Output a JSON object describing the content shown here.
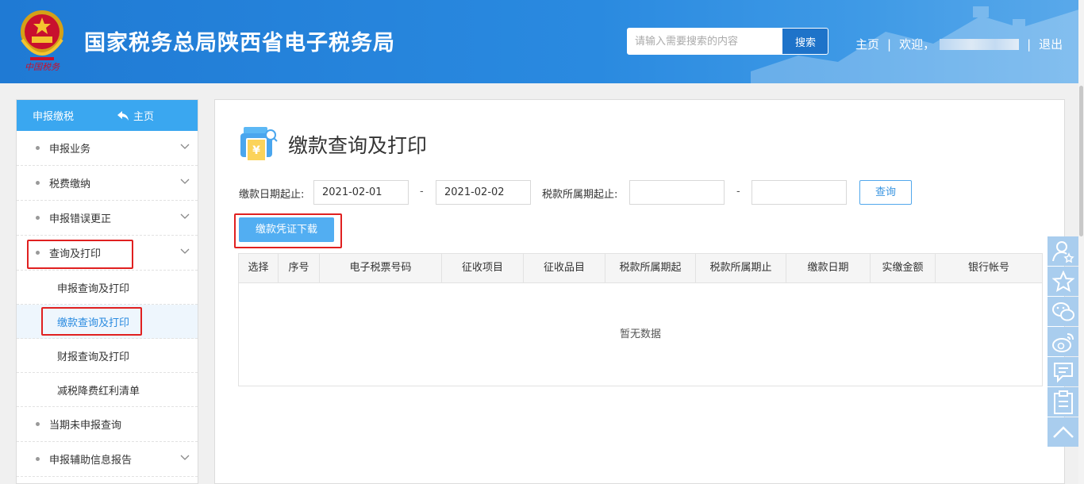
{
  "header": {
    "site_title": "国家税务总局陕西省电子税务局",
    "search_placeholder": "请输入需要搜索的内容",
    "search_button": "搜索",
    "home_link": "主页",
    "separator": "|",
    "welcome": "欢迎，",
    "logout": "退出",
    "emblem_caption": "中国税务"
  },
  "sidebar": {
    "title": "申报缴税",
    "home": "主页",
    "items": [
      {
        "label": "申报业务"
      },
      {
        "label": "税费缴纳"
      },
      {
        "label": "申报错误更正"
      },
      {
        "label": "查询及打印"
      }
    ],
    "subitems": [
      {
        "label": "申报查询及打印"
      },
      {
        "label": "缴款查询及打印"
      },
      {
        "label": "财报查询及打印"
      },
      {
        "label": "减税降费红利清单"
      }
    ],
    "items_after": [
      {
        "label": "当期未申报查询"
      },
      {
        "label": "申报辅助信息报告"
      }
    ]
  },
  "main": {
    "title": "缴款查询及打印",
    "filters": {
      "pay_date_label": "缴款日期起止:",
      "pay_date_start": "2021-02-01",
      "pay_date_end": "2021-02-02",
      "dash": "-",
      "period_label": "税款所属期起止:",
      "period_start": "",
      "period_end": ""
    },
    "query_button": "查询",
    "download_button": "缴款凭证下载",
    "table": {
      "columns": [
        "选择",
        "序号",
        "电子税票号码",
        "征收项目",
        "征收品目",
        "税款所属期起",
        "税款所属期止",
        "缴款日期",
        "实缴金额",
        "银行帐号"
      ],
      "empty_text": "暂无数据"
    }
  },
  "tools": [
    "user-star-icon",
    "star-icon",
    "wechat-icon",
    "weibo-icon",
    "feedback-icon",
    "clipboard-icon",
    "back-to-top-icon"
  ],
  "colors": {
    "header_blue": "#2a8ae0",
    "sidebar_head": "#3aa7f0",
    "primary_button": "#52aef2",
    "highlight_red": "#e02020"
  }
}
